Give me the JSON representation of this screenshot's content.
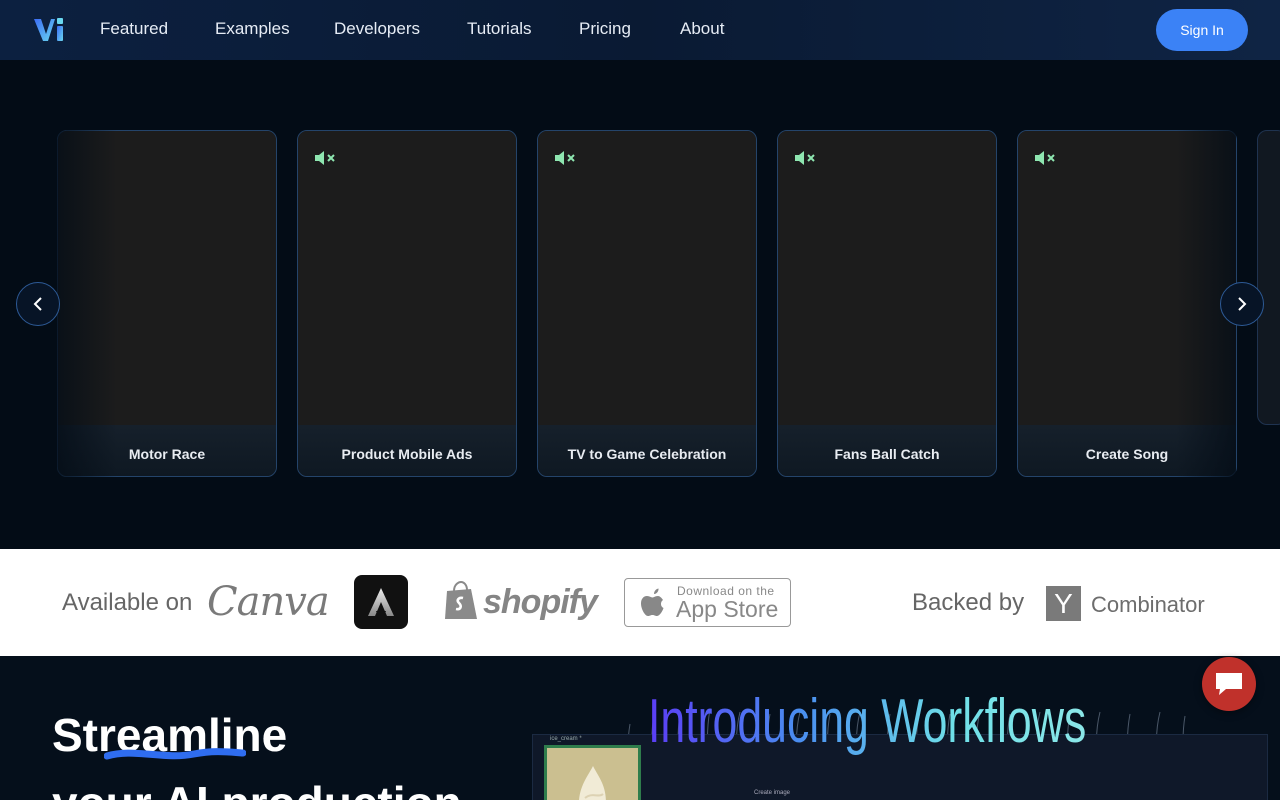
{
  "nav": {
    "links": [
      "Featured",
      "Examples",
      "Developers",
      "Tutorials",
      "Pricing",
      "About"
    ],
    "signin": "Sign In"
  },
  "carousel": {
    "cards": [
      "Motor Race",
      "Product Mobile Ads",
      "TV to Game Celebration",
      "Fans Ball Catch",
      "Create Song"
    ]
  },
  "partners": {
    "available_label": "Available on",
    "canva": "Canva",
    "shopify": "shopify",
    "appstore_small": "Download on the",
    "appstore_big": "App Store",
    "backed_label": "Backed by",
    "yc_letter": "Y",
    "combinator": "Combinator"
  },
  "lower": {
    "headline_line1": "Streamline",
    "headline_line2": "your AI production",
    "workflows_title": "Introducing Workflows",
    "thumb_label": "ice_cream *",
    "create_label": "Create image"
  },
  "colors": {
    "accent": "#3b82f6",
    "card_border": "#24446a",
    "mute_icon": "#8ee6b0",
    "chat": "#c0312b"
  }
}
